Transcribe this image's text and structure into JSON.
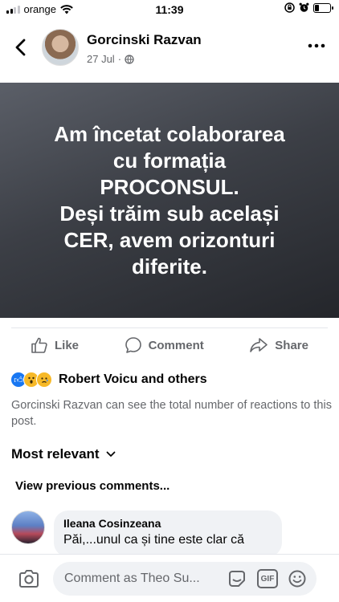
{
  "status_bar": {
    "carrier": "orange",
    "time": "11:39",
    "battery_level": 0.25
  },
  "header": {
    "author": "Gorcinski Razvan",
    "date": "27 Jul",
    "separator": "·",
    "audience_icon": "globe-icon"
  },
  "post": {
    "text": "Am încetat colaborarea\ncu formația\nPROCONSUL.\nDeși trăim sub același\nCER, avem orizonturi\ndiferite."
  },
  "actions": {
    "like": "Like",
    "comment": "Comment",
    "share": "Share"
  },
  "reactions": {
    "icons": [
      "like-icon",
      "wow-icon",
      "sad-icon"
    ],
    "summary": "Robert Voicu and others",
    "note": "Gorcinski Razvan can see the total number of reactions to this post."
  },
  "comments_section": {
    "sort_label": "Most relevant",
    "view_previous": "View previous comments...",
    "comments": [
      {
        "author": "Ileana Cosinzeana",
        "text": "Păi,...unul ca și tine este clar că"
      }
    ]
  },
  "composer": {
    "placeholder": "Comment as Theo Su...",
    "gif_label": "GIF"
  },
  "colors": {
    "text_primary": "#050505",
    "text_secondary": "#65676b",
    "like_blue": "#1877f2",
    "bubble_bg": "#f0f2f5"
  }
}
